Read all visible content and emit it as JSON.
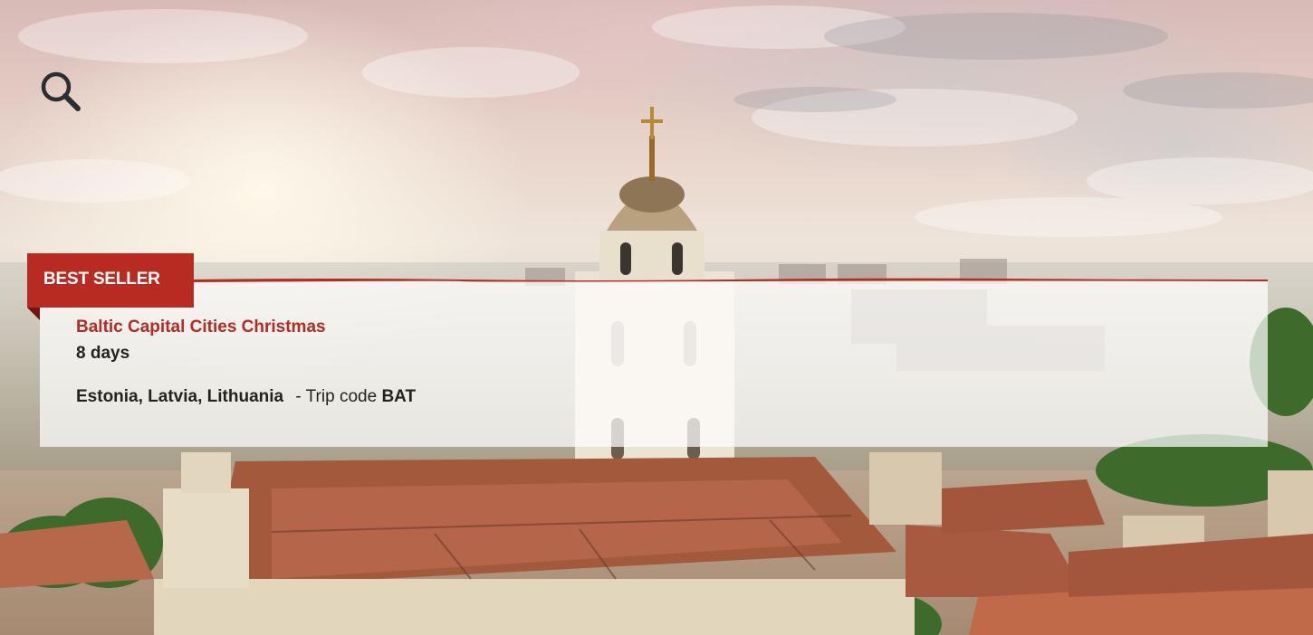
{
  "search": {
    "icon": "search-icon"
  },
  "badge": {
    "label": "BEST SELLER",
    "color": "#b72b22"
  },
  "trip": {
    "title": "Baltic Capital Cities Christmas",
    "duration": "8 days",
    "countries": "Estonia, Latvia, Lithuania",
    "code_prefix": "- Trip code",
    "code": "BAT",
    "title_color": "#b72b22"
  }
}
